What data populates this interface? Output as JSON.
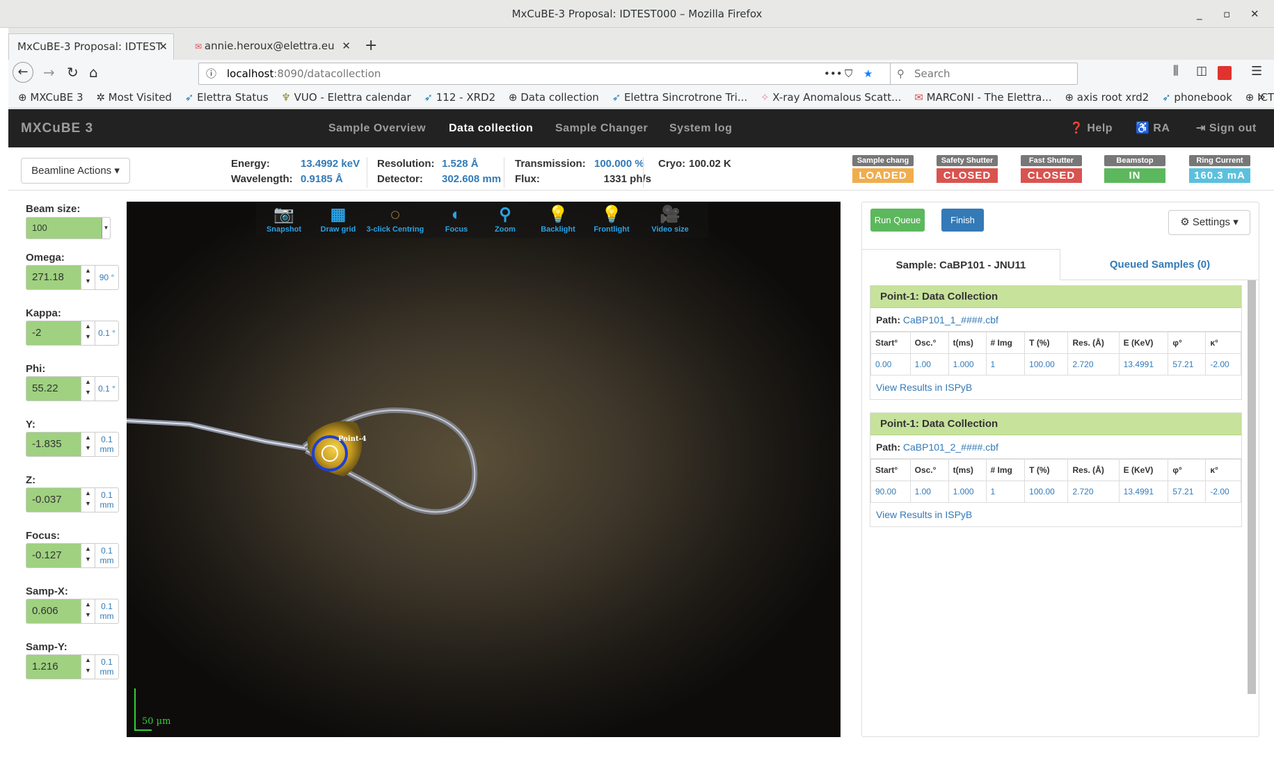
{
  "window": {
    "title": "MxCuBE-3 Proposal: IDTEST000 – Mozilla Firefox",
    "min": "_",
    "max": "▫",
    "close": "✕"
  },
  "tabs": [
    {
      "label": "MxCuBE-3 Proposal: IDTEST",
      "close": "✕"
    },
    {
      "label": "annie.heroux@elettra.eu",
      "close": "✕"
    }
  ],
  "new_tab": "+",
  "url": {
    "host": "localhost",
    "rest": ":8090/datacollection",
    "dots": "•••"
  },
  "search": {
    "placeholder": "Search"
  },
  "bookmarks": [
    "MXCuBE 3",
    "Most Visited",
    "Elettra Status",
    "VUO - Elettra calendar",
    "112 - XRD2",
    "Data collection",
    "Elettra Sincrotrone Tri...",
    "X-ray Anomalous Scatt...",
    "MARCoNI - The Elettra...",
    "axis root xrd2",
    "phonebook",
    "ICTP"
  ],
  "bookmarks_more": "»",
  "app": {
    "brand": "MXCuBE 3",
    "nav": [
      "Sample Overview",
      "Data collection",
      "Sample Changer",
      "System log"
    ],
    "help": "Help",
    "user": "RA",
    "signout": "Sign out"
  },
  "status": {
    "beamline_actions": "Beamline Actions ▾",
    "energy_label": "Energy:",
    "energy": "13.4992 keV",
    "wavelength_label": "Wavelength:",
    "wavelength": "0.9185 Å",
    "resolution_label": "Resolution:",
    "resolution": "1.528 Å",
    "detector_label": "Detector:",
    "detector": "302.608 mm",
    "transmission_label": "Transmission:",
    "transmission": "100.000 %",
    "flux_label": "Flux:",
    "flux": "1331 ph/s",
    "cryo_label": "Cryo:",
    "cryo": "100.02 K",
    "badges": [
      {
        "label": "Sample chang",
        "value": "LOADED",
        "color": "#f0ad4e"
      },
      {
        "label": "Safety Shutter",
        "value": "CLOSED",
        "color": "#d9534f"
      },
      {
        "label": "Fast Shutter",
        "value": "CLOSED",
        "color": "#d9534f"
      },
      {
        "label": "Beamstop",
        "value": "IN",
        "color": "#5cb85c"
      },
      {
        "label": "Ring Current",
        "value": "160.3 mA",
        "color": "#5bc0de"
      }
    ]
  },
  "motors": {
    "beam_size": {
      "label": "Beam size:",
      "value": "100"
    },
    "omega": {
      "label": "Omega:",
      "value": "271.18",
      "step": "90",
      "unit": "°"
    },
    "kappa": {
      "label": "Kappa:",
      "value": "-2",
      "step": "0.1",
      "unit": "°"
    },
    "phi": {
      "label": "Phi:",
      "value": "55.22",
      "step": "0.1",
      "unit": "°"
    },
    "y": {
      "label": "Y:",
      "value": "-1.835",
      "step": "0.1",
      "unit": "mm"
    },
    "z": {
      "label": "Z:",
      "value": "-0.037",
      "step": "0.1",
      "unit": "mm"
    },
    "focus": {
      "label": "Focus:",
      "value": "-0.127",
      "step": "0.1",
      "unit": "mm"
    },
    "sampx": {
      "label": "Samp-X:",
      "value": "0.606",
      "step": "0.1",
      "unit": "mm"
    },
    "sampy": {
      "label": "Samp-Y:",
      "value": "1.216",
      "step": "0.1",
      "unit": "mm"
    }
  },
  "toolbar": {
    "snapshot": "Snapshot",
    "draw_grid": "Draw grid",
    "centring": "3-click Centring",
    "focus": "Focus",
    "zoom": "Zoom",
    "backlight": "Backlight",
    "frontlight": "Frontlight",
    "video_size": "Video size"
  },
  "video": {
    "point_label": "Point-4",
    "scale_label": "50 µm"
  },
  "queue": {
    "run": "Run Queue",
    "finish": "Finish",
    "settings": "Settings ▾",
    "tab_sample": "Sample: CaBP101 - JNU11",
    "tab_queued": "Queued Samples (0)",
    "columns": [
      "Start°",
      "Osc.°",
      "t(ms)",
      "# Img",
      "T (%)",
      "Res. (Å)",
      "E (KeV)",
      "φ°",
      "κ°"
    ],
    "tasks": [
      {
        "title": "Point-1: Data Collection",
        "path_label": "Path:",
        "path": "CaBP101_1_####.cbf",
        "row": [
          "0.00",
          "1.00",
          "1.000",
          "1",
          "100.00",
          "2.720",
          "13.4991",
          "57.21",
          "-2.00"
        ],
        "link": "View Results in ISPyB"
      },
      {
        "title": "Point-1: Data Collection",
        "path_label": "Path:",
        "path": "CaBP101_2_####.cbf",
        "row": [
          "90.00",
          "1.00",
          "1.000",
          "1",
          "100.00",
          "2.720",
          "13.4991",
          "57.21",
          "-2.00"
        ],
        "link": "View Results in ISPyB"
      }
    ]
  }
}
